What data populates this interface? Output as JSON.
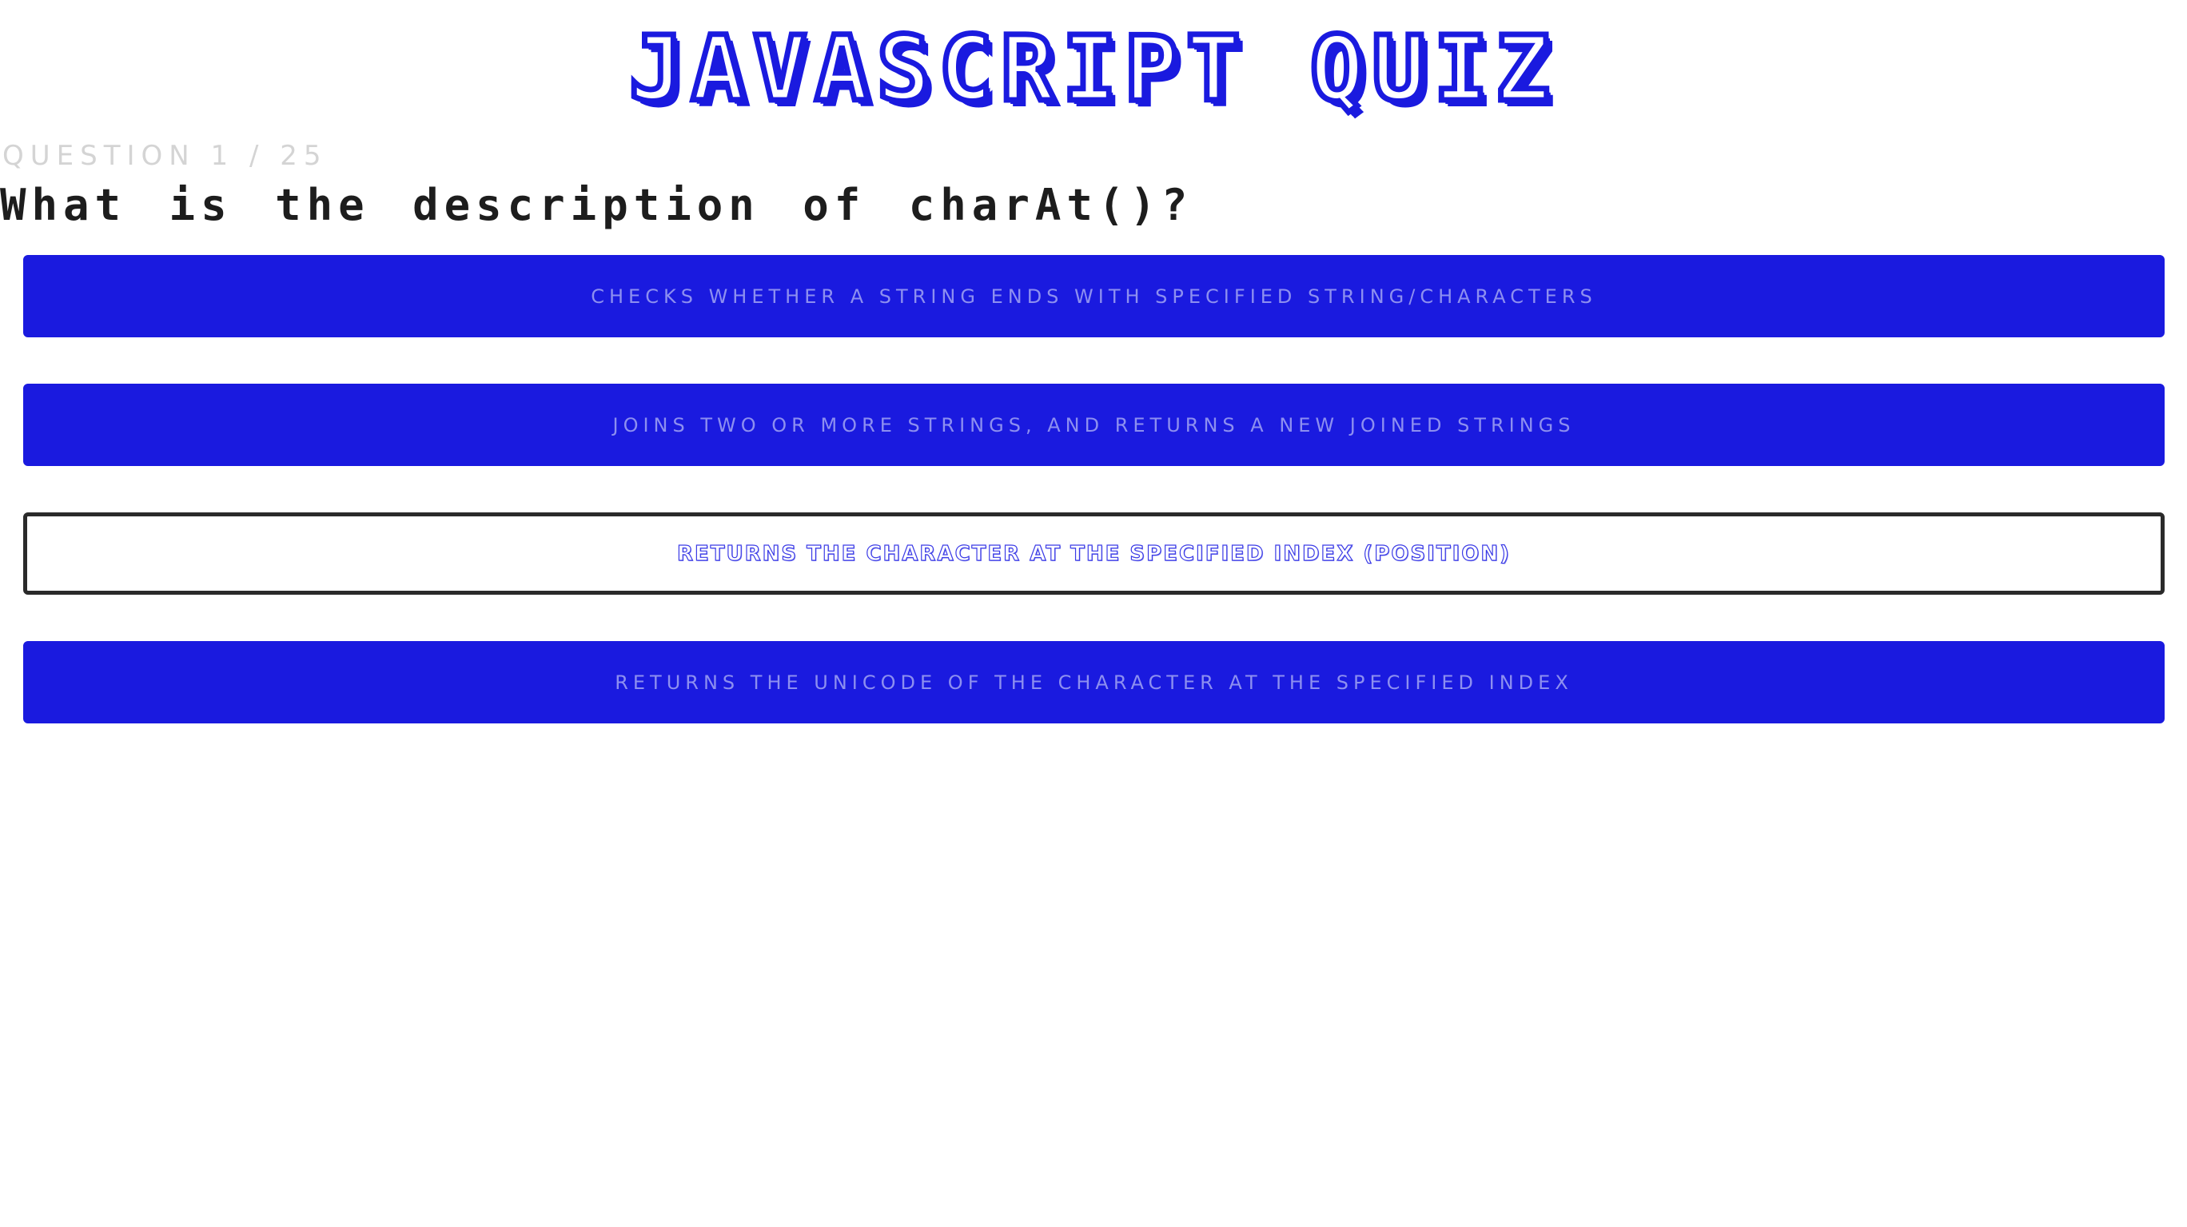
{
  "header": {
    "title": "JAVASCRIPT QUIZ"
  },
  "quiz": {
    "counter": "QUESTION 1 / 25",
    "question": "What is the description of charAt()?",
    "answers": [
      {
        "label": "Checks whether a string ends with specified string/characters",
        "selected": false
      },
      {
        "label": "Joins two or more strings, and returns a new joined strings",
        "selected": false
      },
      {
        "label": "Returns the character at the specified index (position)",
        "selected": true
      },
      {
        "label": "Returns the Unicode of the character at the specified index",
        "selected": false
      }
    ]
  },
  "colors": {
    "accent": "#1a1adf",
    "answer_text": "#8d8ff0",
    "selected_border": "#2a2a2a",
    "counter_text": "#d4d4d4",
    "question_text": "#1d1d1d"
  }
}
